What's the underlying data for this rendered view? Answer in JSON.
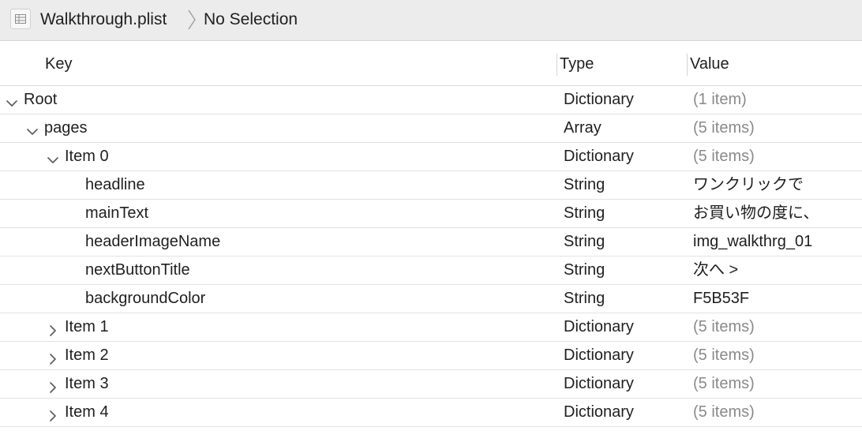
{
  "breadcrumb": {
    "file_name": "Walkthrough.plist",
    "selection": "No Selection"
  },
  "columns": {
    "key": "Key",
    "type": "Type",
    "value": "Value"
  },
  "rows": [
    {
      "key": "Root",
      "type": "Dictionary",
      "value": "(1 item)",
      "depth": 0,
      "disclosure": "expanded",
      "dim": true
    },
    {
      "key": "pages",
      "type": "Array",
      "value": "(5 items)",
      "depth": 1,
      "disclosure": "expanded",
      "dim": true
    },
    {
      "key": "Item 0",
      "type": "Dictionary",
      "value": "(5 items)",
      "depth": 2,
      "disclosure": "expanded",
      "dim": true
    },
    {
      "key": "headline",
      "type": "String",
      "value": "ワンクリックで",
      "depth": 3,
      "disclosure": "none",
      "dim": false
    },
    {
      "key": "mainText",
      "type": "String",
      "value": "お買い物の度に、",
      "depth": 3,
      "disclosure": "none",
      "dim": false
    },
    {
      "key": "headerImageName",
      "type": "String",
      "value": "img_walkthrg_01",
      "depth": 3,
      "disclosure": "none",
      "dim": false
    },
    {
      "key": "nextButtonTitle",
      "type": "String",
      "value": "次へ >",
      "depth": 3,
      "disclosure": "none",
      "dim": false
    },
    {
      "key": "backgroundColor",
      "type": "String",
      "value": "F5B53F",
      "depth": 3,
      "disclosure": "none",
      "dim": false
    },
    {
      "key": "Item 1",
      "type": "Dictionary",
      "value": "(5 items)",
      "depth": 2,
      "disclosure": "collapsed",
      "dim": true
    },
    {
      "key": "Item 2",
      "type": "Dictionary",
      "value": "(5 items)",
      "depth": 2,
      "disclosure": "collapsed",
      "dim": true
    },
    {
      "key": "Item 3",
      "type": "Dictionary",
      "value": "(5 items)",
      "depth": 2,
      "disclosure": "collapsed",
      "dim": true
    },
    {
      "key": "Item 4",
      "type": "Dictionary",
      "value": "(5 items)",
      "depth": 2,
      "disclosure": "collapsed",
      "dim": true
    }
  ],
  "icons": {
    "file": "property-list-file-icon",
    "separator": "breadcrumb-chevron-icon",
    "expanded": "chevron-down-icon",
    "collapsed": "chevron-right-icon"
  }
}
